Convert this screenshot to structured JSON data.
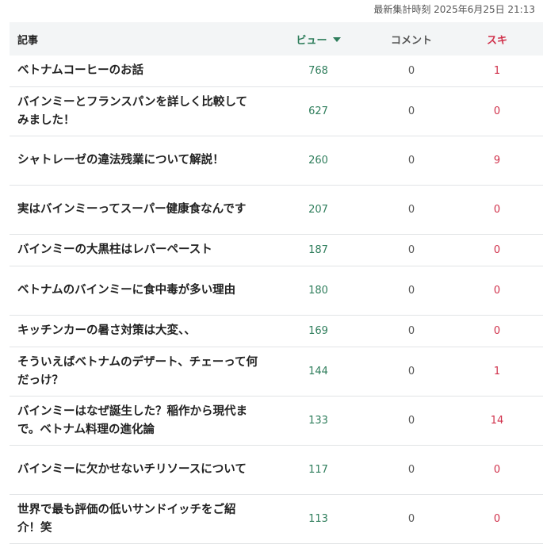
{
  "updated_text": "最新集計時刻 2025年6月25日 21:13",
  "header": {
    "title": "記事",
    "views": "ビュー",
    "comments": "コメント",
    "likes": "スキ"
  },
  "colors": {
    "views": "#2e7d5b",
    "likes": "#d0304a",
    "header_bg": "#f3f5f6"
  },
  "rows": [
    {
      "title": "ベトナムコーヒーのお話",
      "views": "768",
      "comments": "0",
      "likes": "1"
    },
    {
      "title": "バインミーとフランスパンを詳しく比較してみました！",
      "views": "627",
      "comments": "0",
      "likes": "0"
    },
    {
      "title": "シャトレーゼの違法残業について解説！",
      "views": "260",
      "comments": "0",
      "likes": "9"
    },
    {
      "title": "実はバインミーってスーパー健康食なんです",
      "views": "207",
      "comments": "0",
      "likes": "0"
    },
    {
      "title": "バインミーの大黒柱はレバーペースト",
      "views": "187",
      "comments": "0",
      "likes": "0"
    },
    {
      "title": "ベトナムのバインミーに食中毒が多い理由",
      "views": "180",
      "comments": "0",
      "likes": "0"
    },
    {
      "title": "キッチンカーの暑さ対策は大変、、",
      "views": "169",
      "comments": "0",
      "likes": "0"
    },
    {
      "title": "そういえばベトナムのデザート、チェーって何だっけ？",
      "views": "144",
      "comments": "0",
      "likes": "1"
    },
    {
      "title": "バインミーはなぜ誕生した？稲作から現代まで。ベトナム料理の進化論",
      "views": "133",
      "comments": "0",
      "likes": "14"
    },
    {
      "title": "バインミーに欠かせないチリソースについて",
      "views": "117",
      "comments": "0",
      "likes": "0"
    },
    {
      "title": "世界で最も評価の低いサンドイッチをご紹介！笑",
      "views": "113",
      "comments": "0",
      "likes": "0"
    }
  ]
}
